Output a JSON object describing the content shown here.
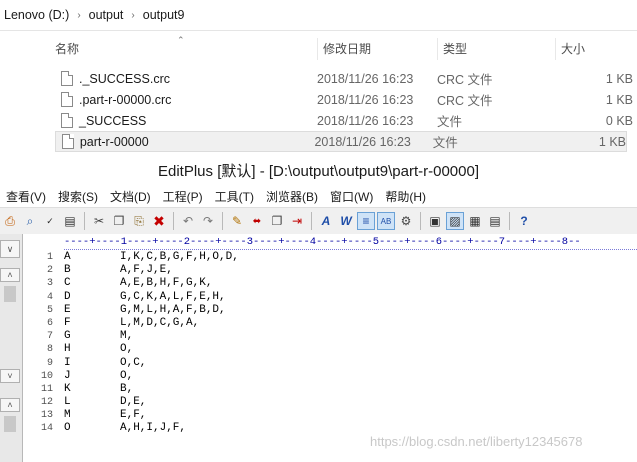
{
  "explorer": {
    "breadcrumb": [
      "Lenovo (D:)",
      "output",
      "output9"
    ],
    "columns": {
      "name": "名称",
      "date": "修改日期",
      "type": "类型",
      "size": "大小"
    },
    "files": [
      {
        "name": "._SUCCESS.crc",
        "date": "2018/11/26 16:23",
        "type": "CRC 文件",
        "size": "1 KB"
      },
      {
        "name": ".part-r-00000.crc",
        "date": "2018/11/26 16:23",
        "type": "CRC 文件",
        "size": "1 KB"
      },
      {
        "name": "_SUCCESS",
        "date": "2018/11/26 16:23",
        "type": "文件",
        "size": "0 KB"
      },
      {
        "name": "part-r-00000",
        "date": "2018/11/26 16:23",
        "type": "文件",
        "size": "1 KB"
      }
    ]
  },
  "editplus": {
    "title": "EditPlus [默认] - [D:\\output\\output9\\part-r-00000]",
    "menu": [
      "查看(V)",
      "搜索(S)",
      "文档(D)",
      "工程(P)",
      "工具(T)",
      "浏览器(B)",
      "窗口(W)",
      "帮助(H)"
    ],
    "ruler": "----+----1----+----2----+----3----+----4----+----5----+----6----+----7----+----8--",
    "lines": [
      {
        "n": "1",
        "key": "A",
        "value": "I,K,C,B,G,F,H,O,D,"
      },
      {
        "n": "2",
        "key": "B",
        "value": "A,F,J,E,"
      },
      {
        "n": "3",
        "key": "C",
        "value": "A,E,B,H,F,G,K,"
      },
      {
        "n": "4",
        "key": "D",
        "value": "G,C,K,A,L,F,E,H,"
      },
      {
        "n": "5",
        "key": "E",
        "value": "G,M,L,H,A,F,B,D,"
      },
      {
        "n": "6",
        "key": "F",
        "value": "L,M,D,C,G,A,"
      },
      {
        "n": "7",
        "key": "G",
        "value": "M,"
      },
      {
        "n": "8",
        "key": "H",
        "value": "O,"
      },
      {
        "n": "9",
        "key": "I",
        "value": "O,C,"
      },
      {
        "n": "10",
        "key": "J",
        "value": "O,"
      },
      {
        "n": "11",
        "key": "K",
        "value": "B,"
      },
      {
        "n": "12",
        "key": "L",
        "value": "D,E,"
      },
      {
        "n": "13",
        "key": "M",
        "value": "E,F,"
      },
      {
        "n": "14",
        "key": "O",
        "value": "A,H,I,J,F,"
      }
    ]
  },
  "watermark": "https://blog.csdn.net/liberty12345678"
}
